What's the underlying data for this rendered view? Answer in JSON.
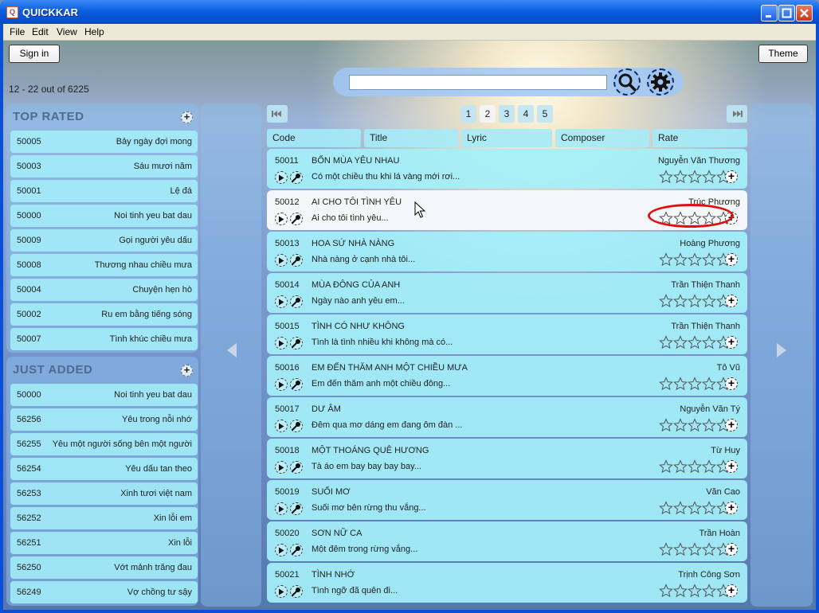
{
  "window": {
    "title": "QUICKKAR",
    "app_icon_glyph": "Q"
  },
  "menu": [
    "File",
    "Edit",
    "View",
    "Help"
  ],
  "toolbar": {
    "sign_in": "Sign in",
    "theme": "Theme",
    "page_info": "12 - 22 out of 6225"
  },
  "search": {
    "value": "",
    "placeholder": ""
  },
  "top_rated": {
    "heading": "TOP RATED",
    "items": [
      {
        "code": "50005",
        "name": "Bảy ngày đợi mong"
      },
      {
        "code": "50003",
        "name": "Sáu mươi năm"
      },
      {
        "code": "50001",
        "name": "Lệ đá"
      },
      {
        "code": "50000",
        "name": "Noi tinh yeu bat dau"
      },
      {
        "code": "50009",
        "name": "Gọi người yêu dấu"
      },
      {
        "code": "50008",
        "name": "Thương nhau chiều mưa"
      },
      {
        "code": "50004",
        "name": "Chuyện hẹn hò"
      },
      {
        "code": "50002",
        "name": "Ru em bằng tiếng sóng"
      },
      {
        "code": "50007",
        "name": "Tình khúc chiều mưa"
      }
    ]
  },
  "just_added": {
    "heading": "JUST ADDED",
    "items": [
      {
        "code": "50000",
        "name": "Noi tinh yeu bat dau"
      },
      {
        "code": "56256",
        "name": "Yêu trong nỗi nhớ"
      },
      {
        "code": "56255",
        "name": "Yêu một người sống bên một người"
      },
      {
        "code": "56254",
        "name": "Yêu dấu tan theo"
      },
      {
        "code": "56253",
        "name": "Xinh tươi việt nam"
      },
      {
        "code": "56252",
        "name": "Xin lỗi em"
      },
      {
        "code": "56251",
        "name": "Xin lỗi"
      },
      {
        "code": "56250",
        "name": "Vớt mảnh trăng đau"
      },
      {
        "code": "56249",
        "name": "Vợ chồng tư sậy"
      }
    ]
  },
  "pager": {
    "pages": [
      "1",
      "2",
      "3",
      "4",
      "5"
    ],
    "active_page": "2"
  },
  "columns": [
    "Code",
    "Title",
    "Lyric",
    "Composer",
    "Rate"
  ],
  "songs": [
    {
      "code": "50011",
      "title": "BỐN MÙA YÊU NHAU",
      "lyric": "Có một chiều thu khi lá vàng mới rơi...",
      "composer": "Nguyễn Văn Thương",
      "rating": 0
    },
    {
      "code": "50012",
      "title": "AI CHO TÔI TÌNH YÊU",
      "lyric": "Ai cho tôi tình yêu...",
      "composer": "Trúc Phương",
      "rating": 0
    },
    {
      "code": "50013",
      "title": "HOA SỨ NHÀ NÀNG",
      "lyric": "Nhà nàng ở cạnh nhà tôi...",
      "composer": "Hoàng Phương",
      "rating": 0
    },
    {
      "code": "50014",
      "title": "MÙA ĐÔNG CỦA ANH",
      "lyric": "Ngày nào anh yêu em...",
      "composer": "Trần Thiện Thanh",
      "rating": 0
    },
    {
      "code": "50015",
      "title": "TÌNH CÓ NHƯ KHÔNG",
      "lyric": "Tình là tình nhiều khi không mà có...",
      "composer": "Trần Thiện Thanh",
      "rating": 0
    },
    {
      "code": "50016",
      "title": "EM ĐẾN THĂM ANH MỘT CHIỀU MƯA",
      "lyric": "Em đến thăm anh một chiều đông...",
      "composer": "Tô Vũ",
      "rating": 0
    },
    {
      "code": "50017",
      "title": "DƯ ÂM",
      "lyric": "Đêm qua mơ dáng em đang ôm đàn ...",
      "composer": "Nguyễn Văn Tý",
      "rating": 0
    },
    {
      "code": "50018",
      "title": "MỘT THOÁNG QUÊ HƯƠNG",
      "lyric": "Tà áo em bay bay bay bay...",
      "composer": "Từ Huy",
      "rating": 0
    },
    {
      "code": "50019",
      "title": "SUỐI MƠ",
      "lyric": "Suối mơ bên rừng thu vắng...",
      "composer": "Văn Cao",
      "rating": 0
    },
    {
      "code": "50020",
      "title": "SƠN NỮ CA",
      "lyric": "Một đêm trong rừng vắng...",
      "composer": "Trần Hoàn",
      "rating": 0
    },
    {
      "code": "50021",
      "title": "TÌNH NHỚ",
      "lyric": "Tình ngỡ đã quên đi...",
      "composer": "Trịnh Công Sơn",
      "rating": 0
    }
  ],
  "selected_row": 1,
  "colors": {
    "accent": "#0a5fe0",
    "row_bg": "#a5f0fa",
    "highlight": "#e01010"
  }
}
